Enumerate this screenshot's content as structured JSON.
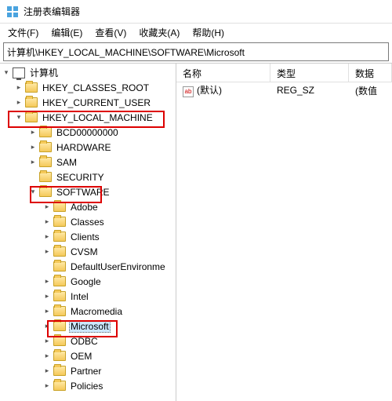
{
  "window": {
    "title": "注册表编辑器"
  },
  "menu": {
    "file": "文件(F)",
    "edit": "编辑(E)",
    "view": "查看(V)",
    "favorites": "收藏夹(A)",
    "help": "帮助(H)"
  },
  "address": "计算机\\HKEY_LOCAL_MACHINE\\SOFTWARE\\Microsoft",
  "columns": {
    "name": "名称",
    "type": "类型",
    "data": "数据"
  },
  "list": {
    "row0": {
      "name": "(默认)",
      "type": "REG_SZ",
      "data": "(数值"
    }
  },
  "tree": {
    "root": "计算机",
    "hkcr": "HKEY_CLASSES_ROOT",
    "hkcu": "HKEY_CURRENT_USER",
    "hklm": "HKEY_LOCAL_MACHINE",
    "bcd": "BCD00000000",
    "hardware": "HARDWARE",
    "sam": "SAM",
    "security": "SECURITY",
    "software": "SOFTWARE",
    "adobe": "Adobe",
    "classes": "Classes",
    "clients": "Clients",
    "cvsm": "CVSM",
    "due": "DefaultUserEnvironme",
    "google": "Google",
    "intel": "Intel",
    "macromedia": "Macromedia",
    "microsoft": "Microsoft",
    "odbc": "ODBC",
    "oem": "OEM",
    "partner": "Partner",
    "policies": "Policies"
  },
  "icons": {
    "ab": "ab"
  }
}
